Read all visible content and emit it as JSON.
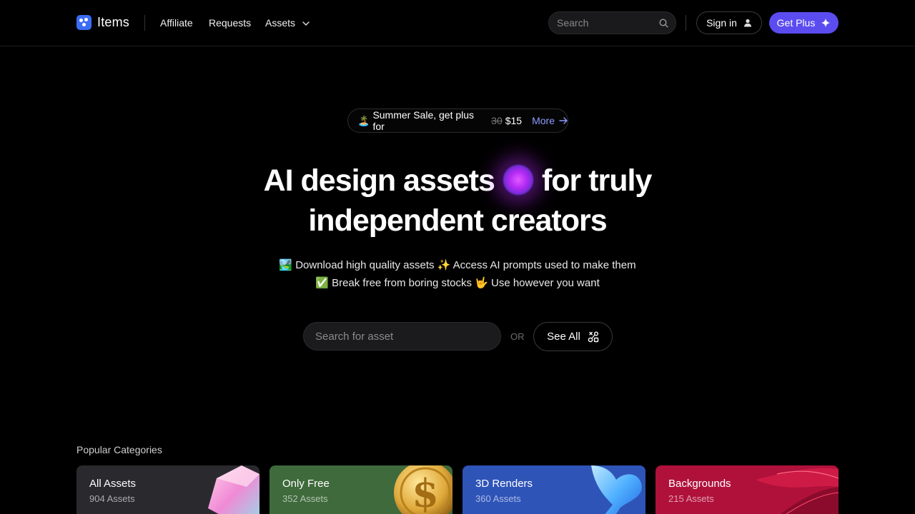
{
  "brand": {
    "name": "Items",
    "accent": "#3b6cf6"
  },
  "nav": {
    "links": [
      {
        "label": "Affiliate"
      },
      {
        "label": "Requests"
      },
      {
        "label": "Assets"
      }
    ],
    "search_placeholder": "Search",
    "signin_label": "Sign in",
    "plus_label": "Get Plus",
    "plus_color": "#5b4cf0"
  },
  "promo": {
    "emoji": "🏝️",
    "text": "Summer Sale, get plus for",
    "old_price": "30",
    "new_price": "$15",
    "more_label": "More"
  },
  "hero": {
    "title_line1_a": "AI design assets",
    "title_line1_b": "for truly",
    "title_line2": "independent creators",
    "sub_line1": "🏞️ Download high quality assets ✨ Access AI prompts used to make them",
    "sub_line2": "✅ Break free from boring stocks 🤟 Use however you want"
  },
  "cta": {
    "search_placeholder": "Search for asset",
    "or_label": "OR",
    "see_all_label": "See All"
  },
  "categories": {
    "title": "Popular Categories",
    "items": [
      {
        "name": "All Assets",
        "count": "904 Assets",
        "color": "#2a2a2e"
      },
      {
        "name": "Only Free",
        "count": "352 Assets",
        "color": "#3f6a3c"
      },
      {
        "name": "3D Renders",
        "count": "360 Assets",
        "color": "#2f54b8"
      },
      {
        "name": "Backgrounds",
        "count": "215 Assets",
        "color": "#b0113b"
      }
    ]
  }
}
